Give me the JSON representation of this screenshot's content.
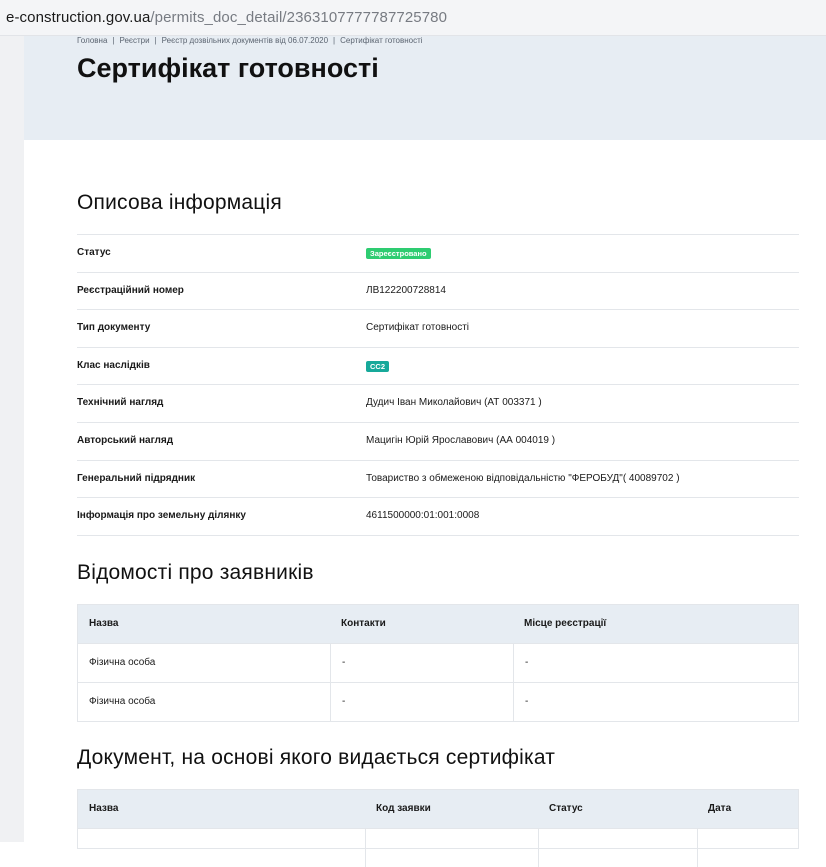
{
  "browser": {
    "url_host": "e-construction.gov.ua",
    "url_path": "/permits_doc_detail/2363107777787725780"
  },
  "breadcrumb": [
    "Головна",
    "Реєстри",
    "Реєстр дозвільних документів від 06.07.2020",
    "Сертифікат готовності"
  ],
  "page_title": "Сертифікат готовності",
  "descriptive": {
    "title": "Описова інформація",
    "rows": [
      {
        "key": "Статус",
        "value": "Зареєстровано",
        "badge": "green"
      },
      {
        "key": "Реєстраційний номер",
        "value": "ЛВ122200728814"
      },
      {
        "key": "Тип документу",
        "value": "Сертифікат готовності"
      },
      {
        "key": "Клас наслідків",
        "value": "СС2",
        "badge": "teal"
      },
      {
        "key": "Технічний нагляд",
        "value": "Дудич Іван Миколайович (АТ 003371 )"
      },
      {
        "key": "Авторський нагляд",
        "value": "Мацигін Юрій Ярославович (АА 004019 )"
      },
      {
        "key": "Генеральний підрядник",
        "value": "Товариство з обмеженою відповідальністю \"ФЕРОБУД\"( 40089702 )"
      },
      {
        "key": "Інформація про земельну ділянку",
        "value": "4611500000:01:001:0008"
      }
    ]
  },
  "applicants": {
    "title": "Відомості про заявників",
    "columns": [
      "Назва",
      "Контакти",
      "Місце реєстрації"
    ],
    "rows": [
      [
        "Фізична особа",
        "-",
        "-"
      ],
      [
        "Фізична особа",
        "-",
        "-"
      ]
    ]
  },
  "basis_document": {
    "title": "Документ, на основі якого видається сертифікат",
    "columns": [
      "Назва",
      "Код заявки",
      "Статус",
      "Дата"
    ],
    "rows": [
      [
        "",
        "",
        "",
        ""
      ]
    ]
  },
  "colors": {
    "status_green": "#2ecc71",
    "class_teal": "#17a99a",
    "hero_bg": "#e7edf3"
  }
}
